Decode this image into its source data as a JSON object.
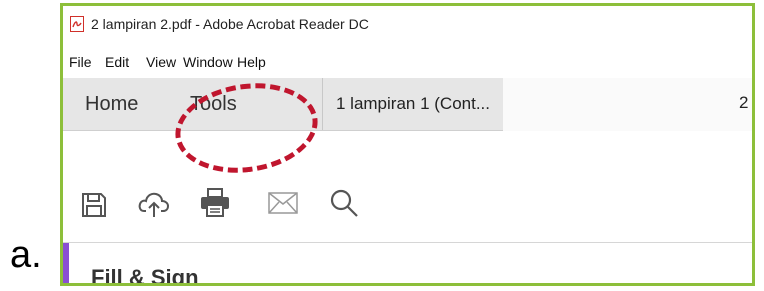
{
  "list_marker": "a.",
  "window": {
    "title": "2 lampiran 2.pdf - Adobe Acrobat Reader DC",
    "app_icon": "acrobat-pdf-icon"
  },
  "menu": {
    "items": [
      "File",
      "Edit",
      "View",
      "Window",
      "Help"
    ]
  },
  "tabs": {
    "home": "Home",
    "tools": "Tools",
    "documents": [
      "1 lampiran 1 (Cont...",
      "2"
    ]
  },
  "toolbar": {
    "icons": [
      "save-icon",
      "cloud-upload-icon",
      "print-icon",
      "email-icon",
      "search-icon"
    ]
  },
  "panel": {
    "title": "Fill & Sign"
  },
  "colors": {
    "frame_border": "#8dbf3a",
    "annotation": "#c0162e",
    "panel_accent": "#8a4fd4"
  }
}
